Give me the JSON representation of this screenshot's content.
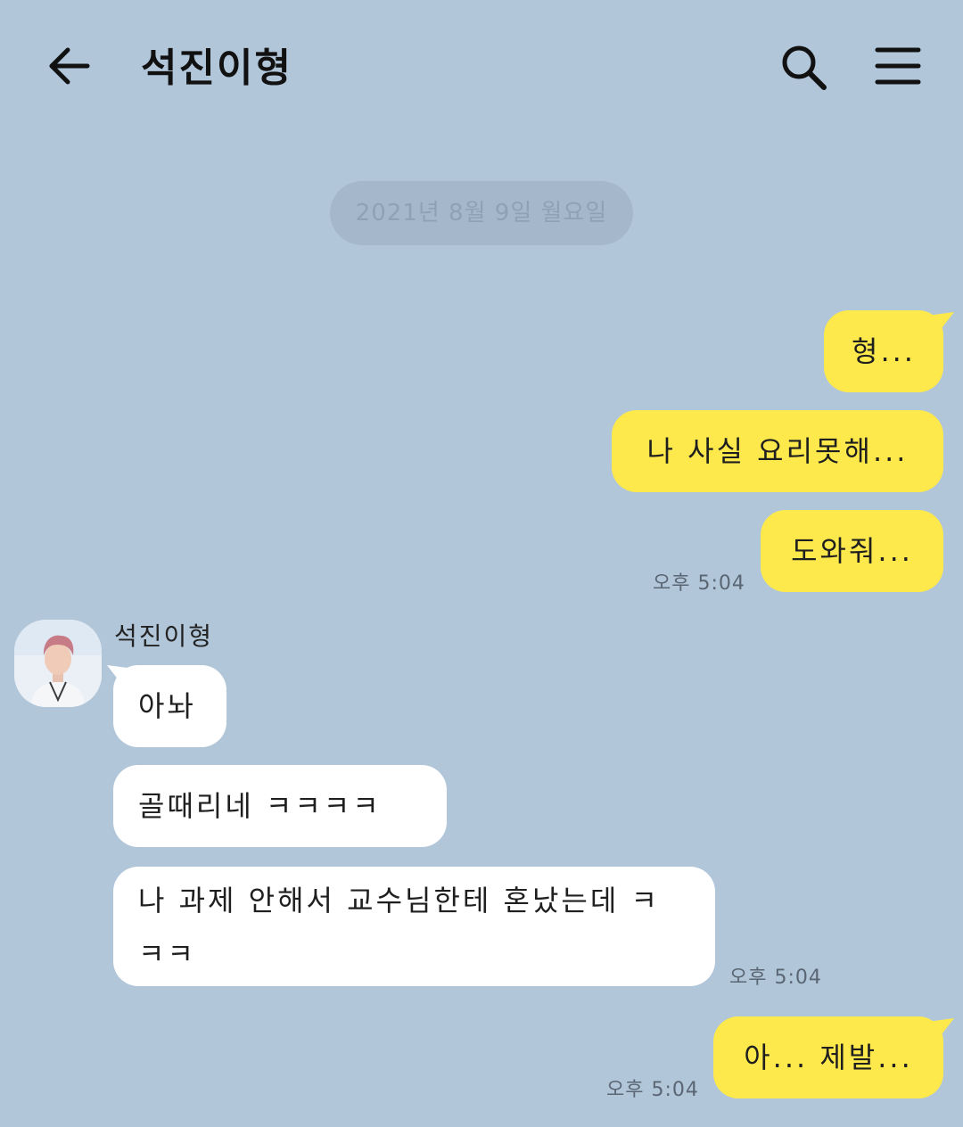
{
  "header": {
    "title": "석진이형",
    "back_icon": "arrow-left-icon",
    "search_icon": "search-icon",
    "menu_icon": "hamburger-menu-icon"
  },
  "date_divider": "2021년 8월 9일 월요일",
  "messages_mine_1": {
    "m1": "형...",
    "m2": "나 사실 요리못해...",
    "m3": "도와줘...",
    "time": "오후 5:04"
  },
  "contact": {
    "name": "석진이형",
    "avatar_icon": "profile-photo"
  },
  "messages_theirs": {
    "m1": "아놔",
    "m2": "골때리네 ㅋㅋㅋㅋ",
    "m3": "나 과제 안해서 교수님한테 혼났는데 ㅋㅋㅋ",
    "time": "오후 5:04"
  },
  "messages_mine_2": {
    "m1": "아... 제발...",
    "time": "오후 5:04"
  },
  "colors": {
    "background": "#b2c6da",
    "my_bubble": "#fde94b",
    "their_bubble": "#ffffff",
    "date_pill": "#a5b8cb"
  }
}
